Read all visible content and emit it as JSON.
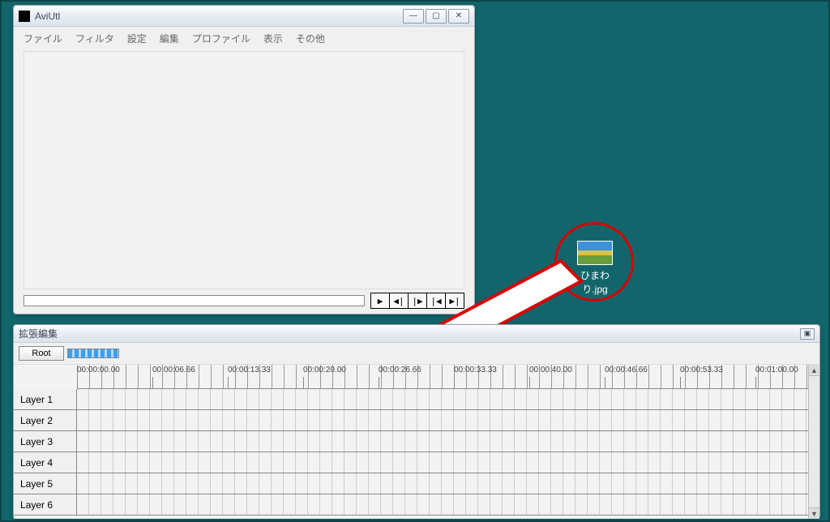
{
  "aviutl": {
    "title": "AviUtl",
    "menu": [
      "ファイル",
      "フィルタ",
      "設定",
      "編集",
      "プロファイル",
      "表示",
      "その他"
    ],
    "playback_icons": [
      "▶",
      "◀|",
      "|▶",
      "|◀",
      "▶|"
    ]
  },
  "desktop_icon": {
    "label": "ひまわり.jpg"
  },
  "timeline": {
    "title": "拡張編集",
    "root_label": "Root",
    "timestamps": [
      "00:00:00.00",
      "00:00:06.66",
      "00:00:13.33",
      "00:00:20.00",
      "00:00:26.66",
      "00:00:33.33",
      "00:00:40.00",
      "00:00:46.66",
      "00:00:53.33",
      "00:01:00.00"
    ],
    "layers": [
      "Layer 1",
      "Layer 2",
      "Layer 3",
      "Layer 4",
      "Layer 5",
      "Layer 6"
    ]
  }
}
